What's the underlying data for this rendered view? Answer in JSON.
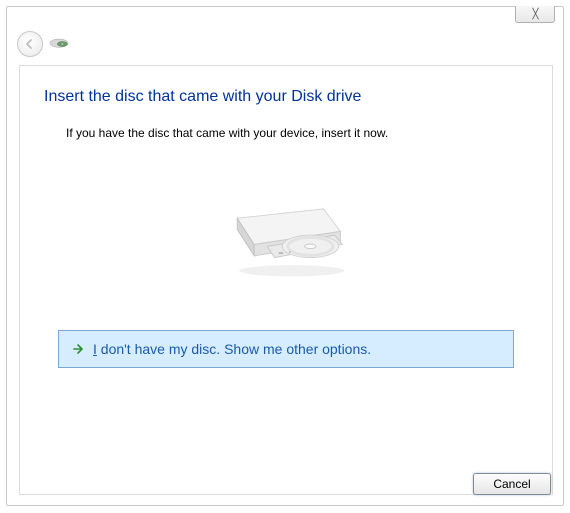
{
  "window": {
    "close_glyph": "✕"
  },
  "content": {
    "heading": "Insert the disc that came with your Disk drive",
    "instruction": "If you have the disc that came with your device, insert it now.",
    "option_prefix": "I",
    "option_rest": " don't have my disc.  Show me other options."
  },
  "footer": {
    "cancel_label": "Cancel"
  }
}
